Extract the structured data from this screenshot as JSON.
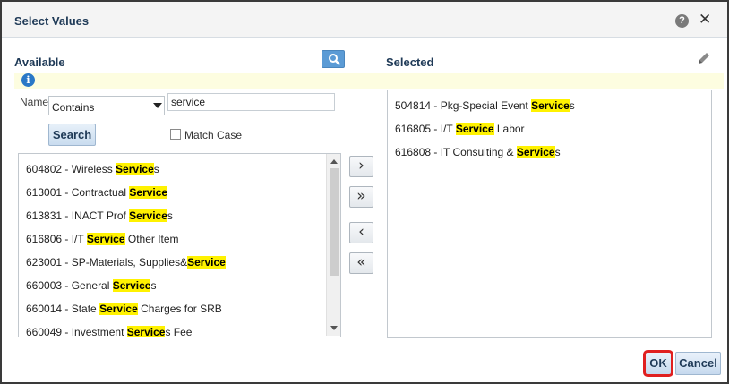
{
  "dialog": {
    "title": "Select Values",
    "help_glyph": "?",
    "close_glyph": "✕"
  },
  "available": {
    "label": "Available",
    "info_glyph": "i",
    "name_label": "Name",
    "operator": "Contains",
    "search_value": "service",
    "search_button": "Search",
    "match_case_label": "Match Case",
    "match_case_checked": false,
    "items": [
      {
        "before": "604802 - Wireless ",
        "match": "Service",
        "after": "s"
      },
      {
        "before": "613001 - Contractual ",
        "match": "Service",
        "after": ""
      },
      {
        "before": "613831 - INACT Prof ",
        "match": "Service",
        "after": "s"
      },
      {
        "before": "616806 - I/T ",
        "match": "Service",
        "after": " Other Item"
      },
      {
        "before": "623001 - SP-Materials, Supplies&",
        "match": "Service",
        "after": ""
      },
      {
        "before": "660003 - General ",
        "match": "Service",
        "after": "s"
      },
      {
        "before": "660014 - State ",
        "match": "Service",
        "after": " Charges for SRB"
      },
      {
        "before": "660049 - Investment ",
        "match": "Service",
        "after": "s Fee"
      }
    ]
  },
  "shuttle": {
    "move": "›",
    "move_all": "»",
    "remove": "‹",
    "remove_all": "«"
  },
  "selected": {
    "label": "Selected",
    "items": [
      {
        "before": "504814 - Pkg-Special Event ",
        "match": "Service",
        "after": "s"
      },
      {
        "before": "616805 - I/T ",
        "match": "Service",
        "after": " Labor"
      },
      {
        "before": "616808 - IT Consulting & ",
        "match": "Service",
        "after": "s"
      }
    ]
  },
  "footer": {
    "ok": "OK",
    "cancel": "Cancel"
  },
  "colors": {
    "highlight": "#fff200",
    "title_text": "#1f3a57",
    "ok_outline": "#e02020",
    "info_bar": "#fdfde0"
  },
  "icons": [
    "help-icon",
    "close-icon",
    "search-icon",
    "pencil-icon",
    "info-icon",
    "chevron-down-icon"
  ]
}
